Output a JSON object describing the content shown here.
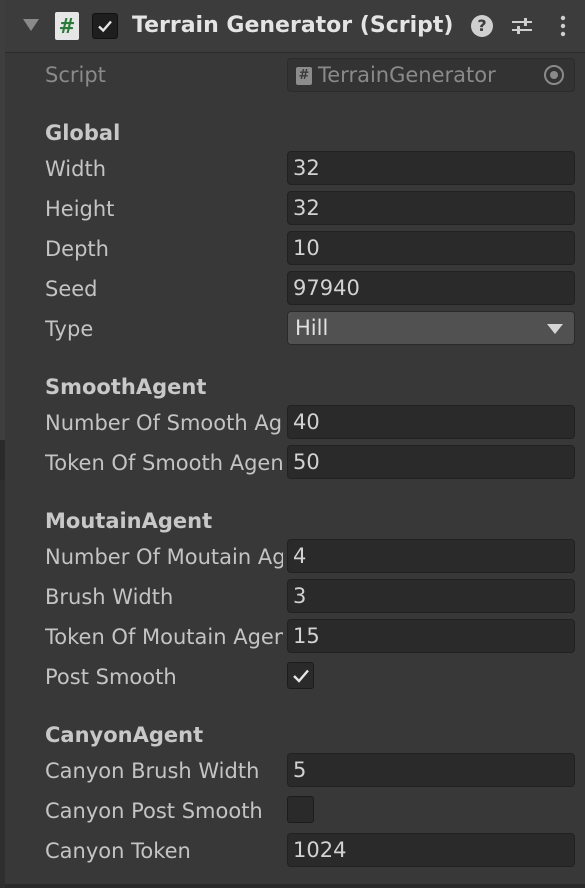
{
  "header": {
    "title": "Terrain Generator (Script)",
    "icons": [
      "foldout-arrow-icon",
      "script-icon",
      "checkbox-icon",
      "help-icon",
      "presets-icon",
      "kebab-menu-icon"
    ],
    "enabled": true
  },
  "script_row": {
    "label": "Script",
    "value": "TerrainGenerator"
  },
  "sections": {
    "global": {
      "title": "Global",
      "width_label": "Width",
      "width_value": "32",
      "height_label": "Height",
      "height_value": "32",
      "depth_label": "Depth",
      "depth_value": "10",
      "seed_label": "Seed",
      "seed_value": "97940",
      "type_label": "Type",
      "type_value": "Hill"
    },
    "smooth": {
      "title": "SmoothAgent",
      "number_label": "Number Of Smooth Agents",
      "number_value": "40",
      "token_label": "Token Of Smooth Agents",
      "token_value": "50"
    },
    "moutain": {
      "title": "MoutainAgent",
      "number_label": "Number Of Moutain Agents",
      "number_value": "4",
      "brush_label": "Brush Width",
      "brush_value": "3",
      "token_label": "Token Of Moutain Agents",
      "token_value": "15",
      "post_smooth_label": "Post Smooth",
      "post_smooth_checked": true
    },
    "canyon": {
      "title": "CanyonAgent",
      "brush_label": "Canyon Brush Width",
      "brush_value": "5",
      "post_smooth_label": "Canyon Post Smooth",
      "post_smooth_checked": false,
      "token_label": "Canyon Token",
      "token_value": "1024"
    }
  },
  "colors": {
    "panel_bg": "#383838",
    "field_bg": "#2a2a2a",
    "dropdown_bg": "#515151",
    "text": "#c4c4c4",
    "script_icon_green": "#2a7a3a"
  }
}
